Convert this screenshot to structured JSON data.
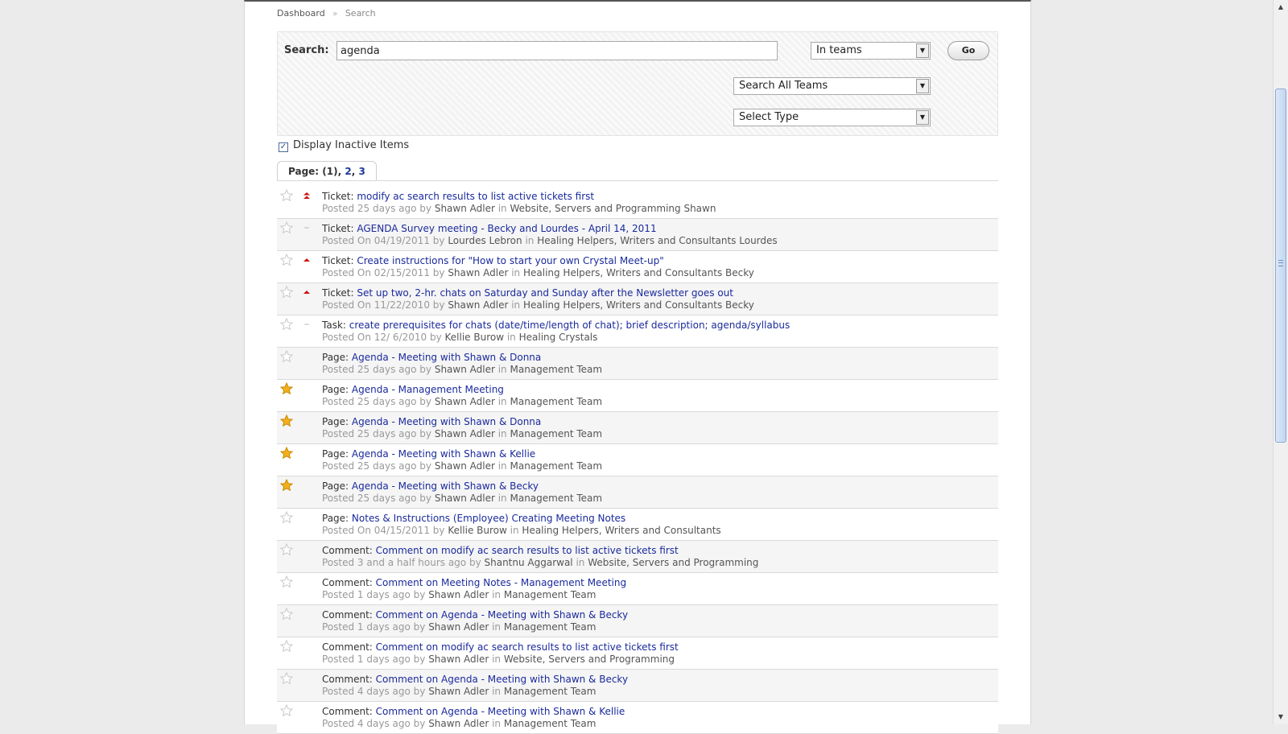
{
  "breadcrumb": {
    "home": "Dashboard",
    "separator": "»",
    "current": "Search"
  },
  "search": {
    "label": "Search:",
    "query": "agenda",
    "scope_select": "In teams",
    "teams_select": "Search All Teams",
    "type_select": "Select Type",
    "go_label": "Go"
  },
  "filters": {
    "display_inactive_label": "Display Inactive Items",
    "display_inactive_checked": true
  },
  "pagination": {
    "label": "Page:",
    "current": "(1)",
    "pages": [
      "2",
      "3"
    ]
  },
  "results": [
    {
      "type": "Ticket:",
      "title": "modify ac search results to list active tickets first",
      "posted": "Posted 25 days ago",
      "by_label": "by",
      "author": "Shawn Adler",
      "in_label": "in",
      "team": "Website, Servers and Programming Shawn",
      "starred": false,
      "priority": "highest"
    },
    {
      "type": "Ticket:",
      "title": "AGENDA Survey meeting - Becky and Lourdes - April 14, 2011",
      "posted": "Posted On 04/19/2011",
      "by_label": "by",
      "author": "Lourdes Lebron",
      "in_label": "in",
      "team": "Healing Helpers, Writers and Consultants Lourdes",
      "starred": false,
      "priority": "normal"
    },
    {
      "type": "Ticket:",
      "title": "Create instructions for \"How to start your own Crystal Meet-up\"",
      "posted": "Posted On 02/15/2011",
      "by_label": "by",
      "author": "Shawn Adler",
      "in_label": "in",
      "team": "Healing Helpers, Writers and Consultants Becky",
      "starred": false,
      "priority": "high"
    },
    {
      "type": "Ticket:",
      "title": "Set up two, 2-hr. chats on Saturday and Sunday after the Newsletter goes out",
      "posted": "Posted On 11/22/2010",
      "by_label": "by",
      "author": "Shawn Adler",
      "in_label": "in",
      "team": "Healing Helpers, Writers and Consultants Becky",
      "starred": false,
      "priority": "high"
    },
    {
      "type": "Task:",
      "title": "create prerequisites for chats (date/time/length of chat); brief description; agenda/syllabus",
      "posted": "Posted On 12/ 6/2010",
      "by_label": "by",
      "author": "Kellie Burow",
      "in_label": "in",
      "team": "Healing Crystals",
      "starred": false,
      "priority": "normal"
    },
    {
      "type": "Page:",
      "title": "Agenda - Meeting with Shawn & Donna",
      "posted": "Posted 25 days ago",
      "by_label": "by",
      "author": "Shawn Adler",
      "in_label": "in",
      "team": "Management Team",
      "starred": false,
      "priority": "none"
    },
    {
      "type": "Page:",
      "title": "Agenda - Management Meeting",
      "posted": "Posted 25 days ago",
      "by_label": "by",
      "author": "Shawn Adler",
      "in_label": "in",
      "team": "Management Team",
      "starred": true,
      "priority": "none"
    },
    {
      "type": "Page:",
      "title": "Agenda - Meeting with Shawn & Donna",
      "posted": "Posted 25 days ago",
      "by_label": "by",
      "author": "Shawn Adler",
      "in_label": "in",
      "team": "Management Team",
      "starred": true,
      "priority": "none"
    },
    {
      "type": "Page:",
      "title": "Agenda - Meeting with Shawn & Kellie",
      "posted": "Posted 25 days ago",
      "by_label": "by",
      "author": "Shawn Adler",
      "in_label": "in",
      "team": "Management Team",
      "starred": true,
      "priority": "none"
    },
    {
      "type": "Page:",
      "title": "Agenda - Meeting with Shawn & Becky",
      "posted": "Posted 25 days ago",
      "by_label": "by",
      "author": "Shawn Adler",
      "in_label": "in",
      "team": "Management Team",
      "starred": true,
      "priority": "none"
    },
    {
      "type": "Page:",
      "title": "Notes & Instructions (Employee) Creating Meeting Notes",
      "posted": "Posted On 04/15/2011",
      "by_label": "by",
      "author": "Kellie Burow",
      "in_label": "in",
      "team": "Healing Helpers, Writers and Consultants",
      "starred": false,
      "priority": "none"
    },
    {
      "type": "Comment:",
      "title": "Comment on modify ac search results to list active tickets first",
      "posted": "Posted 3 and a half hours ago",
      "by_label": "by",
      "author": "Shantnu Aggarwal",
      "in_label": "in",
      "team": "Website, Servers and Programming",
      "starred": false,
      "priority": "none"
    },
    {
      "type": "Comment:",
      "title": "Comment on Meeting Notes - Management Meeting",
      "posted": "Posted 1 days ago",
      "by_label": "by",
      "author": "Shawn Adler",
      "in_label": "in",
      "team": "Management Team",
      "starred": false,
      "priority": "none"
    },
    {
      "type": "Comment:",
      "title": "Comment on Agenda - Meeting with Shawn & Becky",
      "posted": "Posted 1 days ago",
      "by_label": "by",
      "author": "Shawn Adler",
      "in_label": "in",
      "team": "Management Team",
      "starred": false,
      "priority": "none"
    },
    {
      "type": "Comment:",
      "title": "Comment on modify ac search results to list active tickets first",
      "posted": "Posted 1 days ago",
      "by_label": "by",
      "author": "Shawn Adler",
      "in_label": "in",
      "team": "Website, Servers and Programming",
      "starred": false,
      "priority": "none"
    },
    {
      "type": "Comment:",
      "title": "Comment on Agenda - Meeting with Shawn & Becky",
      "posted": "Posted 4 days ago",
      "by_label": "by",
      "author": "Shawn Adler",
      "in_label": "in",
      "team": "Management Team",
      "starred": false,
      "priority": "none"
    },
    {
      "type": "Comment:",
      "title": "Comment on Agenda - Meeting with Shawn & Kellie",
      "posted": "Posted 4 days ago",
      "by_label": "by",
      "author": "Shawn Adler",
      "in_label": "in",
      "team": "Management Team",
      "starred": false,
      "priority": "none"
    }
  ],
  "icons": {
    "star": "star-icon",
    "priority": "priority-icon",
    "checkbox": "checkmark-icon",
    "dropdown": "chevron-down-icon"
  },
  "colors": {
    "link": "#1a2a9c",
    "priority_red": "#cc1111",
    "star_gold": "#f2b01e",
    "star_outline": "#c8c8c8",
    "panel_bg": "#f3f3f3"
  }
}
